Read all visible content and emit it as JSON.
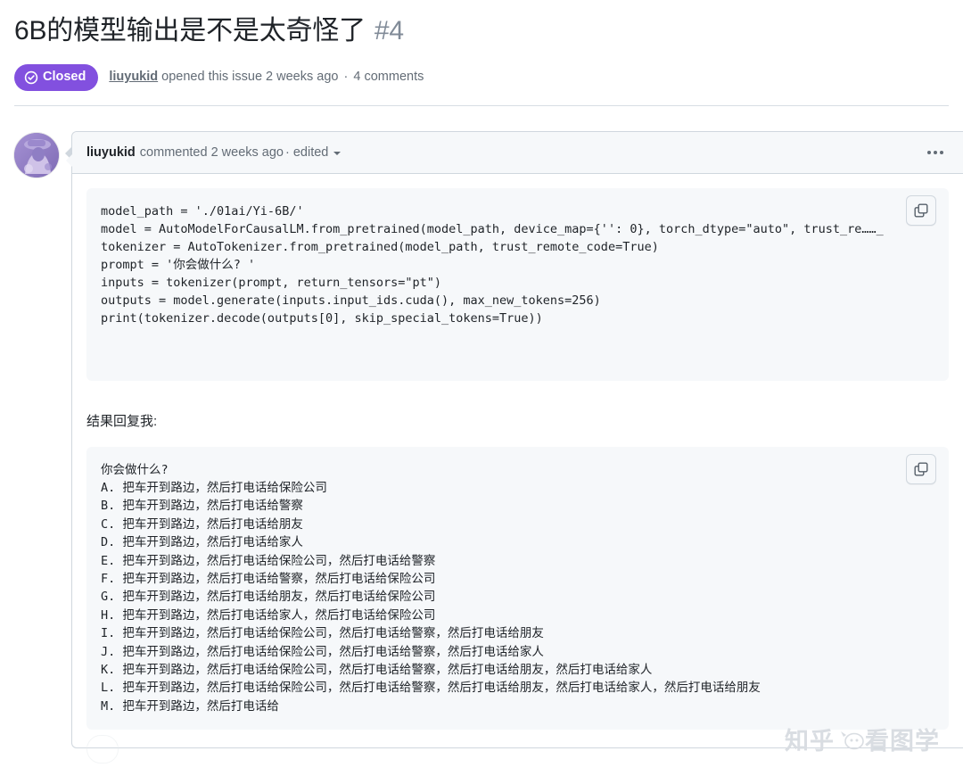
{
  "issue": {
    "title": "6B的模型输出是不是太奇怪了",
    "number": "#4",
    "state_label": "Closed",
    "state_color": "#8250df",
    "author": "liuyukid",
    "meta_opened": "opened this issue 2 weeks ago",
    "meta_separator": "·",
    "meta_comments": "4 comments"
  },
  "comment": {
    "author": "liuyukid",
    "action": "commented 2 weeks ago",
    "separator": "·",
    "edited_label": "edited",
    "menu_icon": "kebab-horizontal-icon",
    "avatar_alt": "liuyukid avatar",
    "code_copy_label": "copy-icon",
    "code_python": "model_path = './01ai/Yi-6B/'\nmodel = AutoModelForCausalLM.from_pretrained(model_path, device_map={'': 0}, torch_dtype=\"auto\", trust_re……_\ntokenizer = AutoTokenizer.from_pretrained(model_path, trust_remote_code=True)\nprompt = '你会做什么? '\ninputs = tokenizer(prompt, return_tensors=\"pt\")\noutputs = model.generate(inputs.input_ids.cuda(), max_new_tokens=256)\nprint(tokenizer.decode(outputs[0], skip_special_tokens=True))",
    "paragraph": "结果回复我:",
    "code_output": "你会做什么?\nA. 把车开到路边，然后打电话给保险公司\nB. 把车开到路边，然后打电话给警察\nC. 把车开到路边，然后打电话给朋友\nD. 把车开到路边，然后打电话给家人\nE. 把车开到路边，然后打电话给保险公司，然后打电话给警察\nF. 把车开到路边，然后打电话给警察，然后打电话给保险公司\nG. 把车开到路边，然后打电话给朋友，然后打电话给保险公司\nH. 把车开到路边，然后打电话给家人，然后打电话给保险公司\nI. 把车开到路边，然后打电话给保险公司，然后打电话给警察，然后打电话给朋友\nJ. 把车开到路边，然后打电话给保险公司，然后打电话给警察，然后打电话给家人\nK. 把车开到路边，然后打电话给保险公司，然后打电话给警察，然后打电话给朋友，然后打电话给家人\nL. 把车开到路边，然后打电话给保险公司，然后打电话给警察，然后打电话给朋友，然后打电话给家人，然后打电话给朋友\nM. 把车开到路边，然后打电话给"
  },
  "watermark": {
    "left_text": "知乎",
    "right_text": "看图学"
  }
}
